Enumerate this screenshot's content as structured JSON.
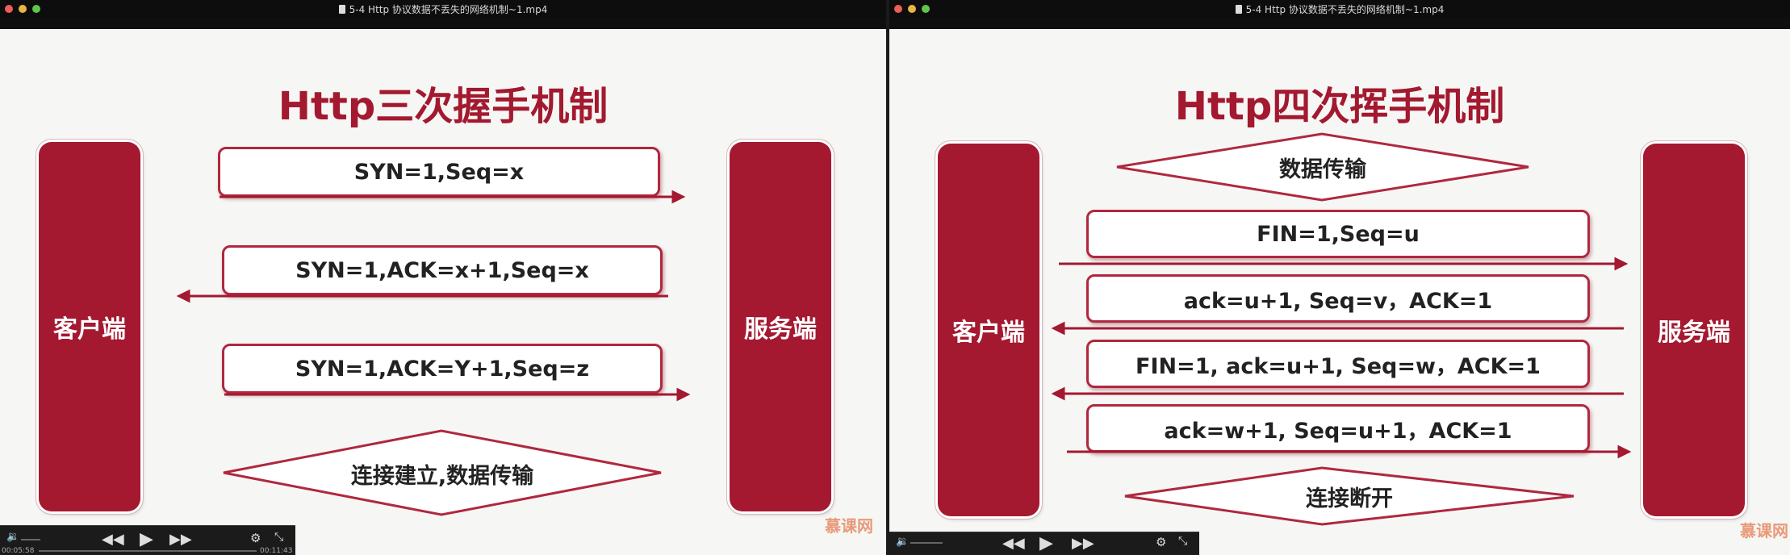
{
  "left_window": {
    "title": "5-4 Http 协议数据不丢失的网络机制~1.mp4",
    "slide_title": "Http三次握手机制",
    "client_label": "客户端",
    "server_label": "服务端",
    "messages": [
      "SYN=1,Seq=x",
      "SYN=1,ACK=x+1,Seq=x",
      "SYN=1,ACK=Y+1,Seq=z"
    ],
    "footer_diamond": "连接建立,数据传输",
    "controls": {
      "time_elapsed": "00:05:58",
      "time_remaining": "00:11:43"
    },
    "watermark": "慕课网"
  },
  "right_window": {
    "title": "5-4 Http 协议数据不丢失的网络机制~1.mp4",
    "slide_title": "Http四次挥手机制",
    "client_label": "客户端",
    "server_label": "服务端",
    "header_diamond": "数据传输",
    "messages": [
      "FIN=1,Seq=u",
      "ack=u+1, Seq=v，ACK=1",
      "FIN=1, ack=u+1, Seq=w，ACK=1",
      "ack=w+1, Seq=u+1，ACK=1"
    ],
    "footer_diamond": "连接断开",
    "watermark": "慕课网"
  },
  "colors": {
    "accent": "#a41830",
    "border": "#b0283e",
    "background": "#f6f7f5"
  },
  "icons": [
    "close-icon",
    "minimize-icon",
    "zoom-icon",
    "file-icon",
    "volume-icon",
    "rewind-icon",
    "play-icon",
    "fast-forward-icon",
    "settings-icon",
    "fullscreen-icon"
  ]
}
